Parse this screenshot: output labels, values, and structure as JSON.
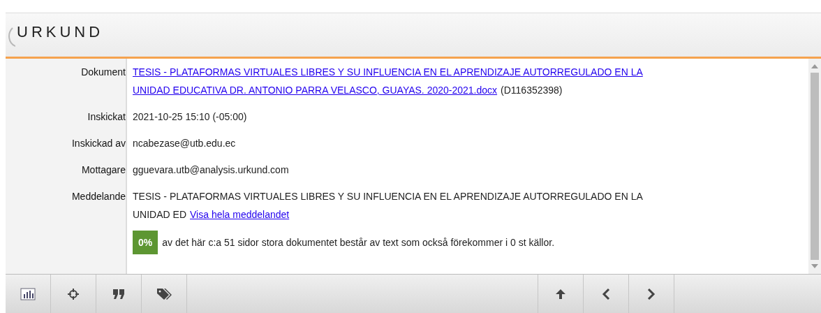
{
  "logo": {
    "text": "URKUND"
  },
  "fields": [
    {
      "kind": "link",
      "label": "Dokument",
      "link_lines": [
        "TESIS - PLATAFORMAS VIRTUALES LIBRES Y SU INFLUENCIA EN EL APRENDIZAJE AUTORREGULADO EN LA",
        "UNIDAD EDUCATIVA DR. ANTONIO PARRA VELASCO, GUAYAS. 2020-2021.docx"
      ],
      "suffix": "(D116352398)"
    },
    {
      "kind": "text",
      "label": "Inskickat",
      "value": "2021-10-25 15:10 (-05:00)"
    },
    {
      "kind": "text",
      "label": "Inskickad av",
      "value": "ncabezase@utb.edu.ec"
    },
    {
      "kind": "text",
      "label": "Mottagare",
      "value": "gguevara.utb@analysis.urkund.com"
    },
    {
      "kind": "message",
      "label": "Meddelande",
      "value_lines": [
        "TESIS - PLATAFORMAS VIRTUALES LIBRES Y SU INFLUENCIA EN EL APRENDIZAJE AUTORREGULADO EN LA",
        "UNIDAD ED"
      ],
      "link": "Visa hela meddelandet"
    }
  ],
  "summary": {
    "badge": "0%",
    "text": "av det här c:a 51 sidor stora dokumentet består av text som också förekommer i 0 st källor."
  }
}
